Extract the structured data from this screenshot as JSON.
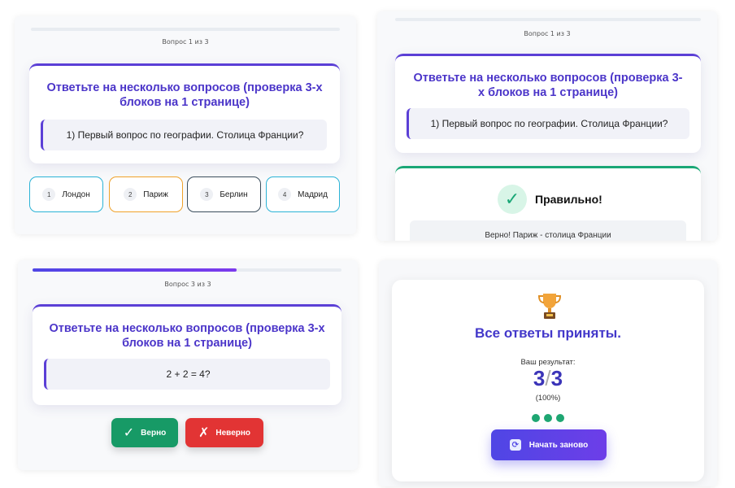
{
  "quiz1": {
    "counter": "Вопрос 1 из 3",
    "progress": 0,
    "title": "Ответьте на несколько вопросов (проверка 3-х блоков на 1 странице)",
    "question": "1) Первый вопрос по географии. Столица Франции?",
    "options": [
      {
        "num": "1",
        "label": "Лондон",
        "color": "#2bb3d6"
      },
      {
        "num": "2",
        "label": "Париж",
        "color": "#f0a22a"
      },
      {
        "num": "3",
        "label": "Берлин",
        "color": "#3a4d5c"
      },
      {
        "num": "4",
        "label": "Мадрид",
        "color": "#2bb3d6"
      }
    ]
  },
  "quiz2": {
    "counter": "Вопрос 1 из 3",
    "progress": 0,
    "title": "Ответьте на несколько вопросов (проверка 3-х блоков на 1 странице)",
    "question": "1) Первый вопрос по географии. Столица Франции?",
    "result_title": "Правильно!",
    "feedback": "Верно! Париж - столица Франции"
  },
  "quiz3": {
    "counter": "Вопрос 3 из 3",
    "progress": 0.66,
    "title": "Ответьте на несколько вопросов (проверка 3-х блоков на 1 странице)",
    "question": "2 + 2 = 4?",
    "true_label": "Верно",
    "false_label": "Неверно",
    "true_color": "#179a66",
    "false_color": "#e23434"
  },
  "final": {
    "title": "Все ответы приняты.",
    "score_label": "Ваш результат:",
    "score_num": "3",
    "score_den": "3",
    "percent": "(100%)",
    "dots": 3,
    "restart_label": "Начать заново"
  }
}
